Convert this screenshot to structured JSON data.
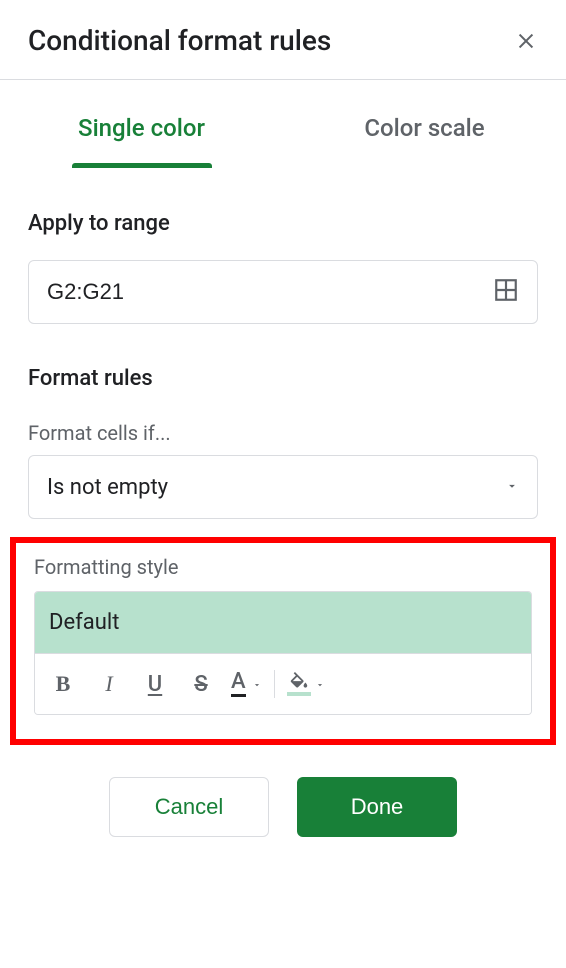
{
  "header": {
    "title": "Conditional format rules"
  },
  "tabs": {
    "single_color": "Single color",
    "color_scale": "Color scale"
  },
  "apply_range": {
    "title": "Apply to range",
    "value": "G2:G21"
  },
  "format_rules": {
    "title": "Format rules",
    "cells_if_label": "Format cells if...",
    "condition": "Is not empty"
  },
  "formatting_style": {
    "label": "Formatting style",
    "preview_text": "Default"
  },
  "toolbar": {
    "bold": "B",
    "italic": "I",
    "underline": "U",
    "strike": "S",
    "text_color": "A"
  },
  "buttons": {
    "cancel": "Cancel",
    "done": "Done"
  }
}
